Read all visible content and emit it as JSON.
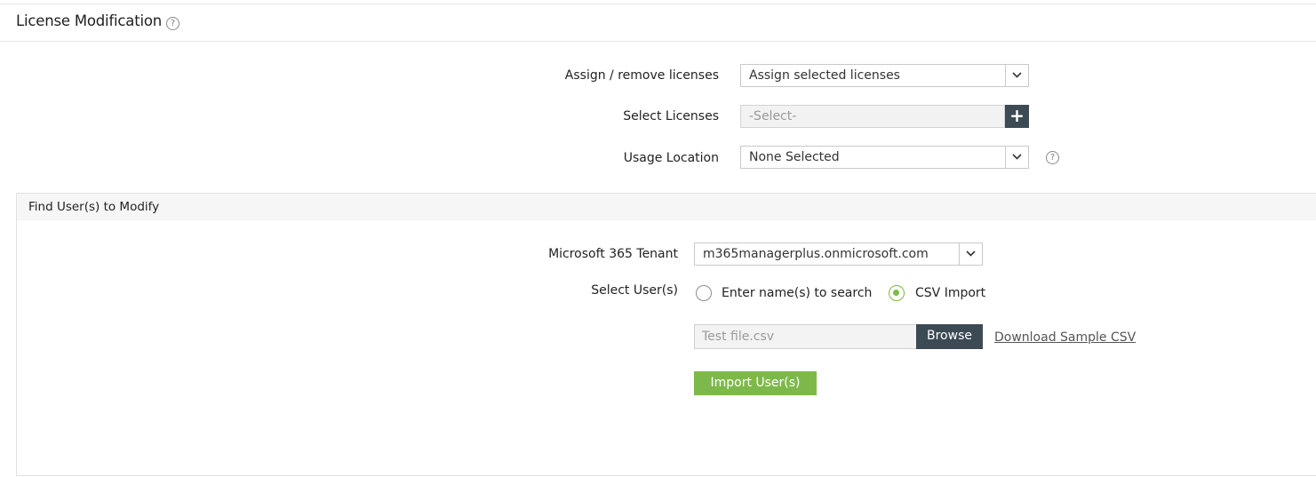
{
  "page": {
    "title": "License Modification"
  },
  "form": {
    "assign_label": "Assign / remove licenses",
    "assign_value": "Assign selected licenses",
    "licenses_label": "Select Licenses",
    "licenses_placeholder": "-Select-",
    "location_label": "Usage Location",
    "location_value": "None Selected"
  },
  "find_panel": {
    "title": "Find User(s) to Modify",
    "tenant_label": "Microsoft 365 Tenant",
    "tenant_value": "m365managerplus.onmicrosoft.com",
    "select_users_label": "Select User(s)",
    "radio_search_label": "Enter name(s) to search",
    "radio_csv_label": "CSV Import",
    "selected_option": "CSV Import",
    "file_value": "Test file.csv",
    "browse_label": "Browse",
    "download_link": "Download Sample CSV",
    "import_button": "Import User(s)"
  },
  "icons": {
    "help": "question-circle-icon",
    "dropdown": "chevron-down-icon",
    "add": "plus-icon"
  },
  "colors": {
    "accent_green": "#7db94a",
    "dark_button": "#3c4a54",
    "radio_checked": "#7dbb47"
  }
}
